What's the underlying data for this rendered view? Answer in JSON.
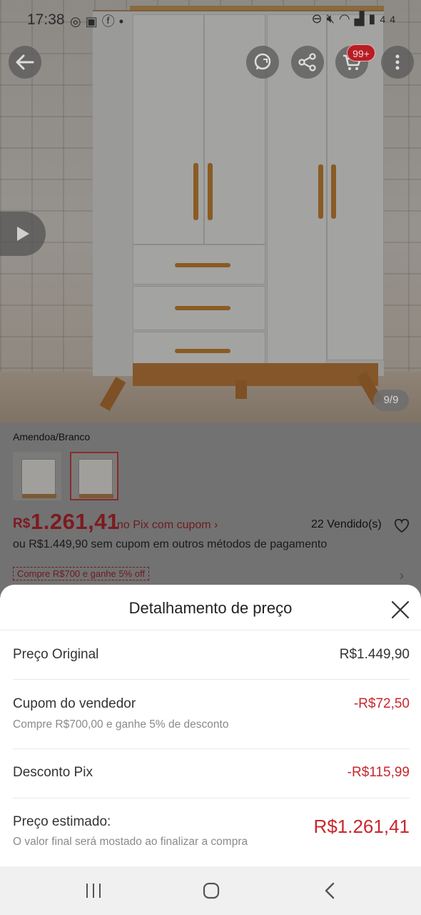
{
  "status_bar": {
    "time": "17:38",
    "left_icons": [
      "whatsapp-icon",
      "notification-icon",
      "facebook-icon",
      "dot-icon"
    ],
    "right_icons": [
      "dnd-icon",
      "mute-icon",
      "wifi-icon",
      "signal-icon",
      "battery-icon"
    ],
    "battery_level": "44"
  },
  "top_actions": {
    "badge": "99+"
  },
  "gallery": {
    "counter": "9/9"
  },
  "product": {
    "variant_label": "Amendoa/Branco",
    "thumbnails": [
      {
        "name": "thumb-variant-1",
        "selected": false
      },
      {
        "name": "thumb-variant-2",
        "selected": true
      }
    ],
    "price_prefix": "R$",
    "price": "1.261,41",
    "price_note": "no Pix com cupom ›",
    "sold": "22 Vendido(s)",
    "alt_price": "ou R$1.449,90 sem cupom em outros métodos de pagamento",
    "promo": "Compre R$700 e ganhe 5% off"
  },
  "sheet": {
    "title": "Detalhamento de preço",
    "rows": [
      {
        "label": "Preço Original",
        "sub": "",
        "value": "R$1.449,90",
        "highlight": false
      },
      {
        "label": "Cupom do vendedor",
        "sub": "Compre R$700,00 e ganhe 5% de desconto",
        "value": "-R$72,50",
        "highlight": true
      },
      {
        "label": "Desconto Pix",
        "sub": "",
        "value": "-R$115,99",
        "highlight": true
      }
    ],
    "total": {
      "label": "Preço estimado:",
      "sub": "O valor final será mostado ao finalizar a compra",
      "value": "R$1.261,41"
    }
  },
  "colors": {
    "accent_red": "#c8272d",
    "dim_overlay": "#6b6b6b",
    "sheet_bg": "#ffffff"
  }
}
